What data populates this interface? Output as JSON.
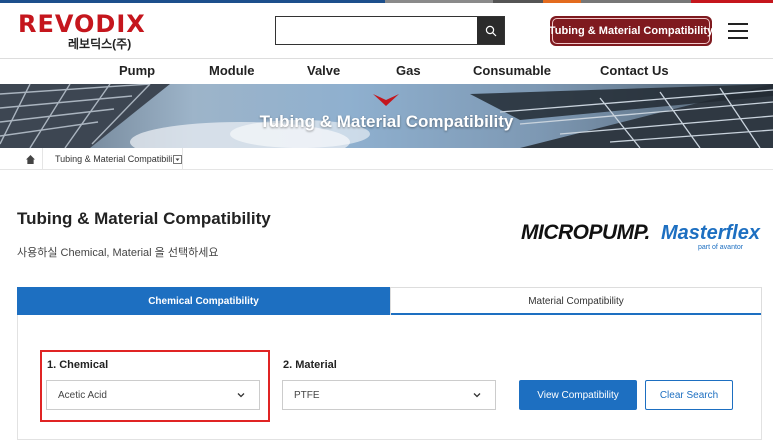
{
  "header": {
    "logo_text": "REVODIX",
    "logo_subtext": "레보딕스(주)",
    "search_placeholder": "",
    "compat_button": "Tubing & Material Compatibility",
    "colors": {
      "brand_red": "#c5161d",
      "button_maroon": "#7f1a1f"
    }
  },
  "nav": {
    "items": [
      "Pump",
      "Module",
      "Valve",
      "Gas",
      "Consumable",
      "Contact Us"
    ]
  },
  "banner": {
    "title": "Tubing & Material Compatibility"
  },
  "breadcrumb": {
    "current": "Tubing & Material Compatibili"
  },
  "page": {
    "title": "Tubing & Material Compatibility",
    "subtitle": "사용하실 Chemical, Material 을 선택하세요"
  },
  "partners": {
    "micropump": "MICROPUMP.",
    "masterflex": "Masterflex",
    "masterflex_tagline": "part of avantor"
  },
  "tabs": {
    "active": "Chemical Compatibility",
    "inactive": "Material Compatibility"
  },
  "form": {
    "chemical_label": "1. Chemical",
    "chemical_value": "Acetic Acid",
    "material_label": "2. Material",
    "material_value": "PTFE",
    "view_button": "View Compatibility",
    "clear_button": "Clear Search",
    "colors": {
      "primary_blue": "#1d6fc1",
      "highlight_red": "#e02424"
    }
  },
  "icons": [
    "search-icon",
    "menu-icon",
    "home-icon",
    "chevron-down-icon"
  ]
}
